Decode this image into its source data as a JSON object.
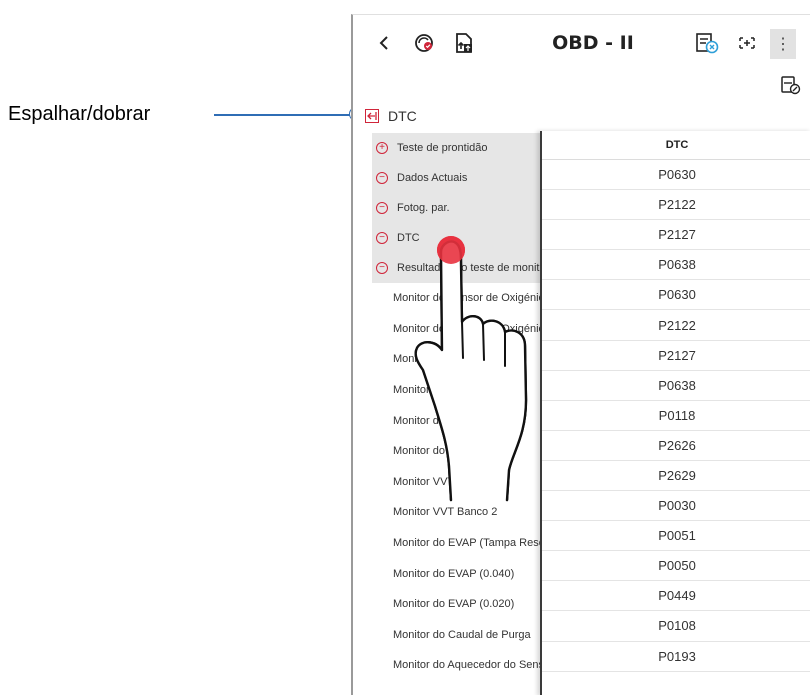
{
  "callout": {
    "label": "Espalhar/dobrar"
  },
  "topbar": {
    "title": "OBD - II",
    "back_icon": "chevron-left-icon",
    "menu_glyph": "⋮"
  },
  "dtc_header": {
    "label": "DTC"
  },
  "tree": {
    "items": [
      {
        "symbol": "+",
        "label": "Teste de prontidão"
      },
      {
        "symbol": "−",
        "label": "Dados Actuais"
      },
      {
        "symbol": "−",
        "label": "Fotog. par."
      },
      {
        "symbol": "−",
        "label": "DTC"
      },
      {
        "symbol": "−",
        "label": "Resultados do teste de monitor"
      }
    ],
    "sub_items": [
      "Monitor do Sensor de Oxigénio",
      "Monitor do Sensor de Oxigénio",
      "Monitor",
      "Monitor",
      "Monitor do Banco",
      "Monitor do Banco",
      "Monitor VVT Banco 1",
      "Monitor VVT Banco 2",
      "Monitor do EVAP (Tampa Reservatório)",
      "Monitor do EVAP (0.040)",
      "Monitor do EVAP (0.020)",
      "Monitor do Caudal de Purga",
      "Monitor do Aquecedor do Sensor"
    ]
  },
  "table": {
    "header": "DTC",
    "rows": [
      "P0630",
      "P2122",
      "P2127",
      "P0638",
      "P0630",
      "P2122",
      "P2127",
      "P0638",
      "P0118",
      "P2626",
      "P2629",
      "P0030",
      "P0051",
      "P0050",
      "P0449",
      "P0108",
      "P0193"
    ]
  },
  "colors": {
    "accent_red": "#d0253a",
    "callout_blue": "#2f6db5",
    "touch_red": "#e8323f"
  }
}
